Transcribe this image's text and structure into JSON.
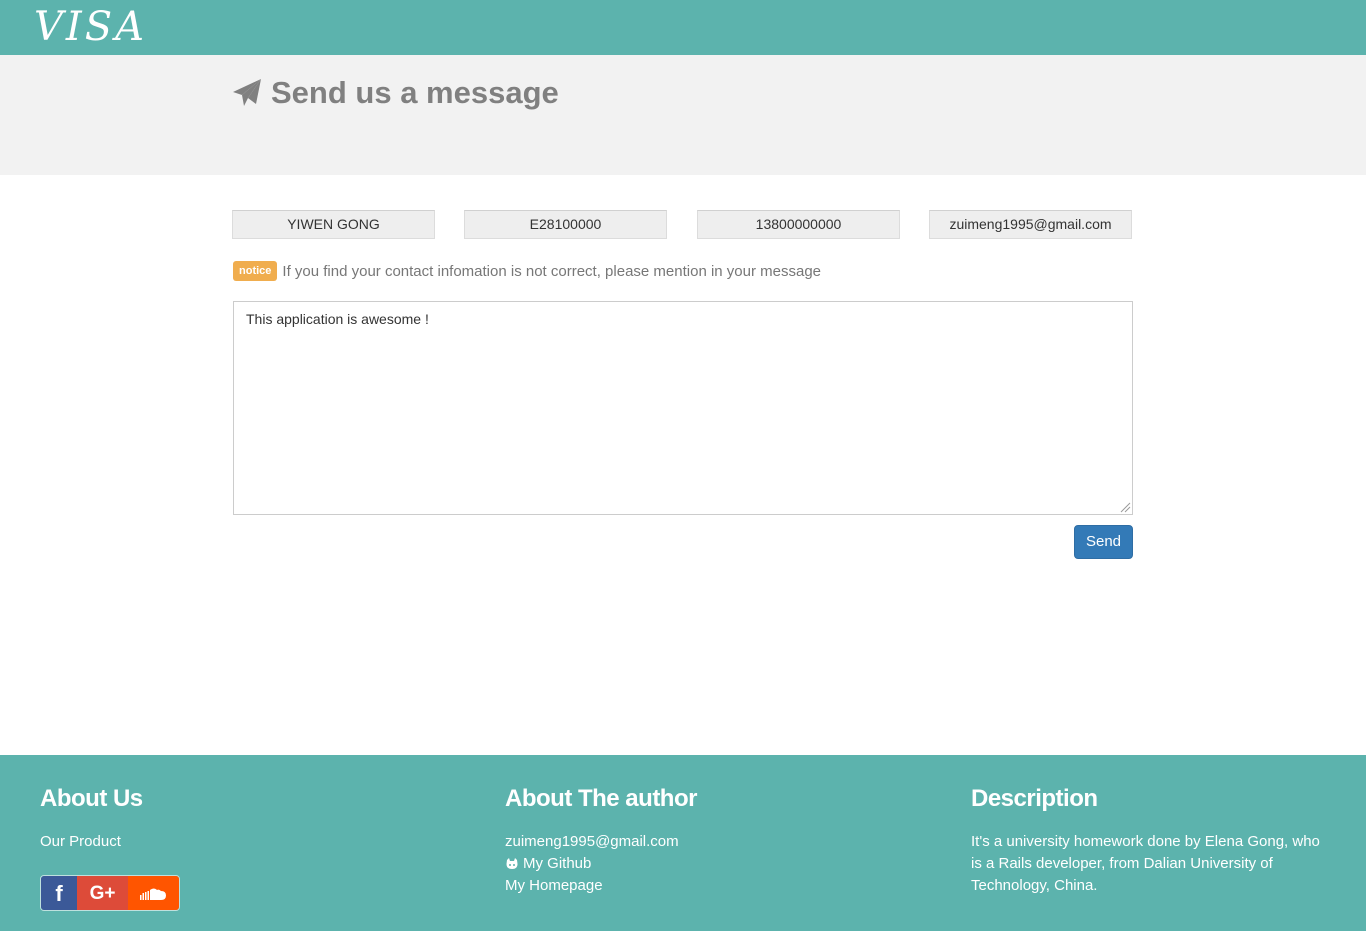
{
  "navbar": {
    "brand": "VISA"
  },
  "header": {
    "title": "Send us a message",
    "icon": "paper-plane-icon"
  },
  "contact": {
    "name": "YIWEN GONG",
    "passport": "E28100000",
    "phone": "13800000000",
    "email": "zuimeng1995@gmail.com"
  },
  "notice": {
    "badge": "notice",
    "text": "If you find your contact infomation is not correct, please mention in your message"
  },
  "message": {
    "value": "This application is awesome !"
  },
  "send_label": "Send",
  "footer": {
    "about_us": {
      "heading": "About Us",
      "product_link": "Our Product"
    },
    "author": {
      "heading": "About The author",
      "email": "zuimeng1995@gmail.com",
      "github": "My Github",
      "homepage": "My Homepage"
    },
    "description": {
      "heading": "Description",
      "line1": "It's a university homework done by Elena Gong, who",
      "line2": "is a Rails developer, from Dalian University of",
      "line3": "Technology, China."
    },
    "social": {
      "facebook": "f",
      "googleplus": "G+",
      "soundcloud_icon": "soundcloud-icon"
    }
  },
  "colors": {
    "navbar": "#5cb3ad",
    "header_band": "#f2f2f2",
    "badge": "#f0ad4e",
    "send_button": "#337ab7",
    "facebook": "#3b5998",
    "googleplus": "#dd4b39",
    "soundcloud": "#ff5500"
  }
}
